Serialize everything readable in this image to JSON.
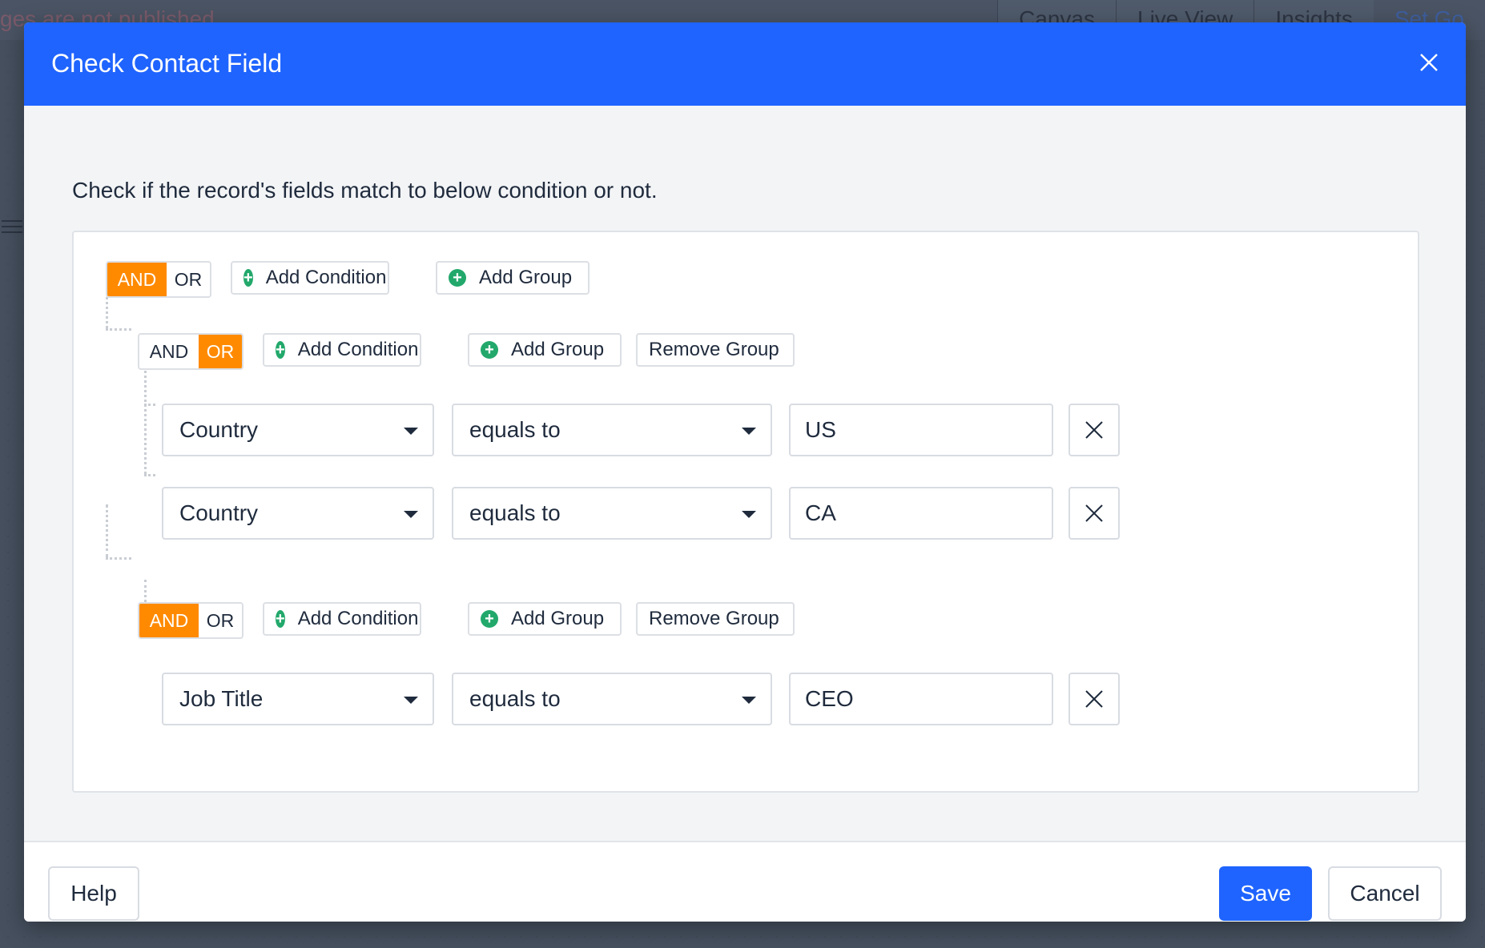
{
  "background": {
    "message": "ges are not published",
    "tabs": [
      "Canvas",
      "Live View",
      "Insights"
    ],
    "link": "Set Go"
  },
  "modal": {
    "title": "Check Contact Field",
    "intro": "Check if the record's fields match to below condition or not.",
    "root": {
      "and_label": "AND",
      "or_label": "OR",
      "active": "AND",
      "add_condition": "Add Condition",
      "add_group": "Add Group"
    },
    "groups": [
      {
        "and_label": "AND",
        "or_label": "OR",
        "active": "OR",
        "add_condition": "Add Condition",
        "add_group": "Add Group",
        "remove_group": "Remove Group",
        "conditions": [
          {
            "field": "Country",
            "operator": "equals to",
            "value": "US"
          },
          {
            "field": "Country",
            "operator": "equals to",
            "value": "CA"
          }
        ]
      },
      {
        "and_label": "AND",
        "or_label": "OR",
        "active": "AND",
        "add_condition": "Add Condition",
        "add_group": "Add Group",
        "remove_group": "Remove Group",
        "conditions": [
          {
            "field": "Job Title",
            "operator": "equals to",
            "value": "CEO"
          }
        ]
      }
    ],
    "footer": {
      "help": "Help",
      "save": "Save",
      "cancel": "Cancel"
    }
  },
  "colors": {
    "header": "#1f64ff",
    "toggle_active": "#ff8a00",
    "add_icon": "#22a86b",
    "primary_button": "#1f64ff"
  },
  "icons": {
    "close": "close-icon",
    "add": "plus-circle-icon",
    "caret": "caret-down-icon",
    "remove": "x-icon"
  }
}
